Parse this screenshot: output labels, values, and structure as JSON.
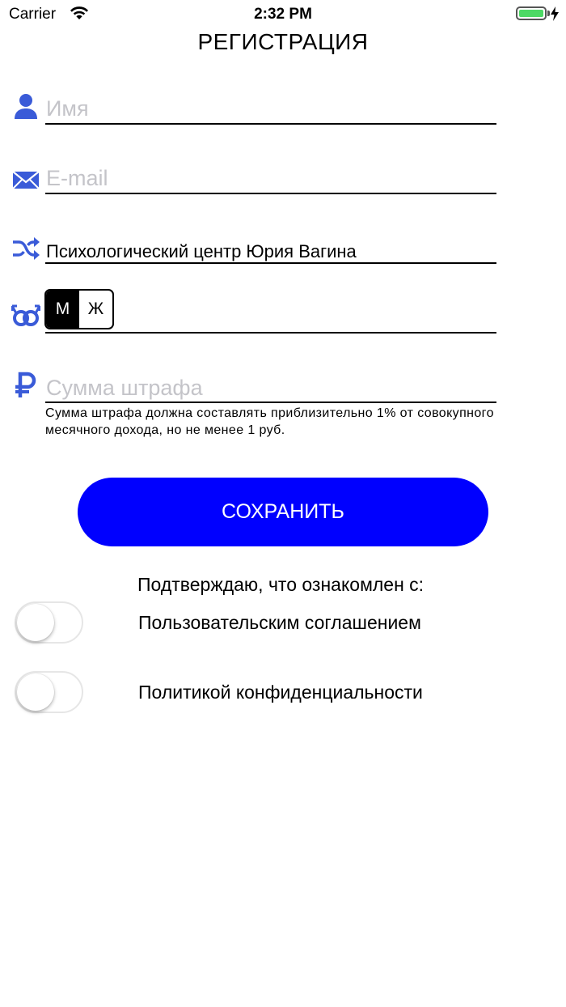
{
  "status_bar": {
    "carrier": "Carrier",
    "time": "2:32 PM",
    "battery_color": "#4cd964"
  },
  "page": {
    "title": "РЕГИСТРАЦИЯ"
  },
  "form": {
    "name_field": {
      "icon": "user-icon",
      "placeholder": "Имя"
    },
    "email_field": {
      "icon": "envelope-icon",
      "placeholder": "E-mail"
    },
    "organization_field": {
      "icon": "shuffle-icon",
      "value": "Психологический центр Юрия Вагина"
    },
    "gender_field": {
      "icon": "gender-icon",
      "options": [
        "М",
        "Ж"
      ],
      "selected": "М"
    },
    "fine_field": {
      "icon": "ruble-icon",
      "placeholder": "Сумма штрафа",
      "hint": "Сумма штрафа должна составлять приблизительно 1% от совокупного месячного дохода, но не менее 1 руб."
    },
    "save_label": "СОХРАНИТЬ"
  },
  "agreements": {
    "heading": "Подтверждаю, что ознакомлен с:",
    "items": [
      {
        "label": "Пользовательским соглашением",
        "checked": false
      },
      {
        "label": "Политикой конфиденциальности",
        "checked": false
      }
    ]
  },
  "colors": {
    "accent": "#0000ff",
    "icon": "#3a5bd8",
    "placeholder": "#c4c4c9"
  }
}
